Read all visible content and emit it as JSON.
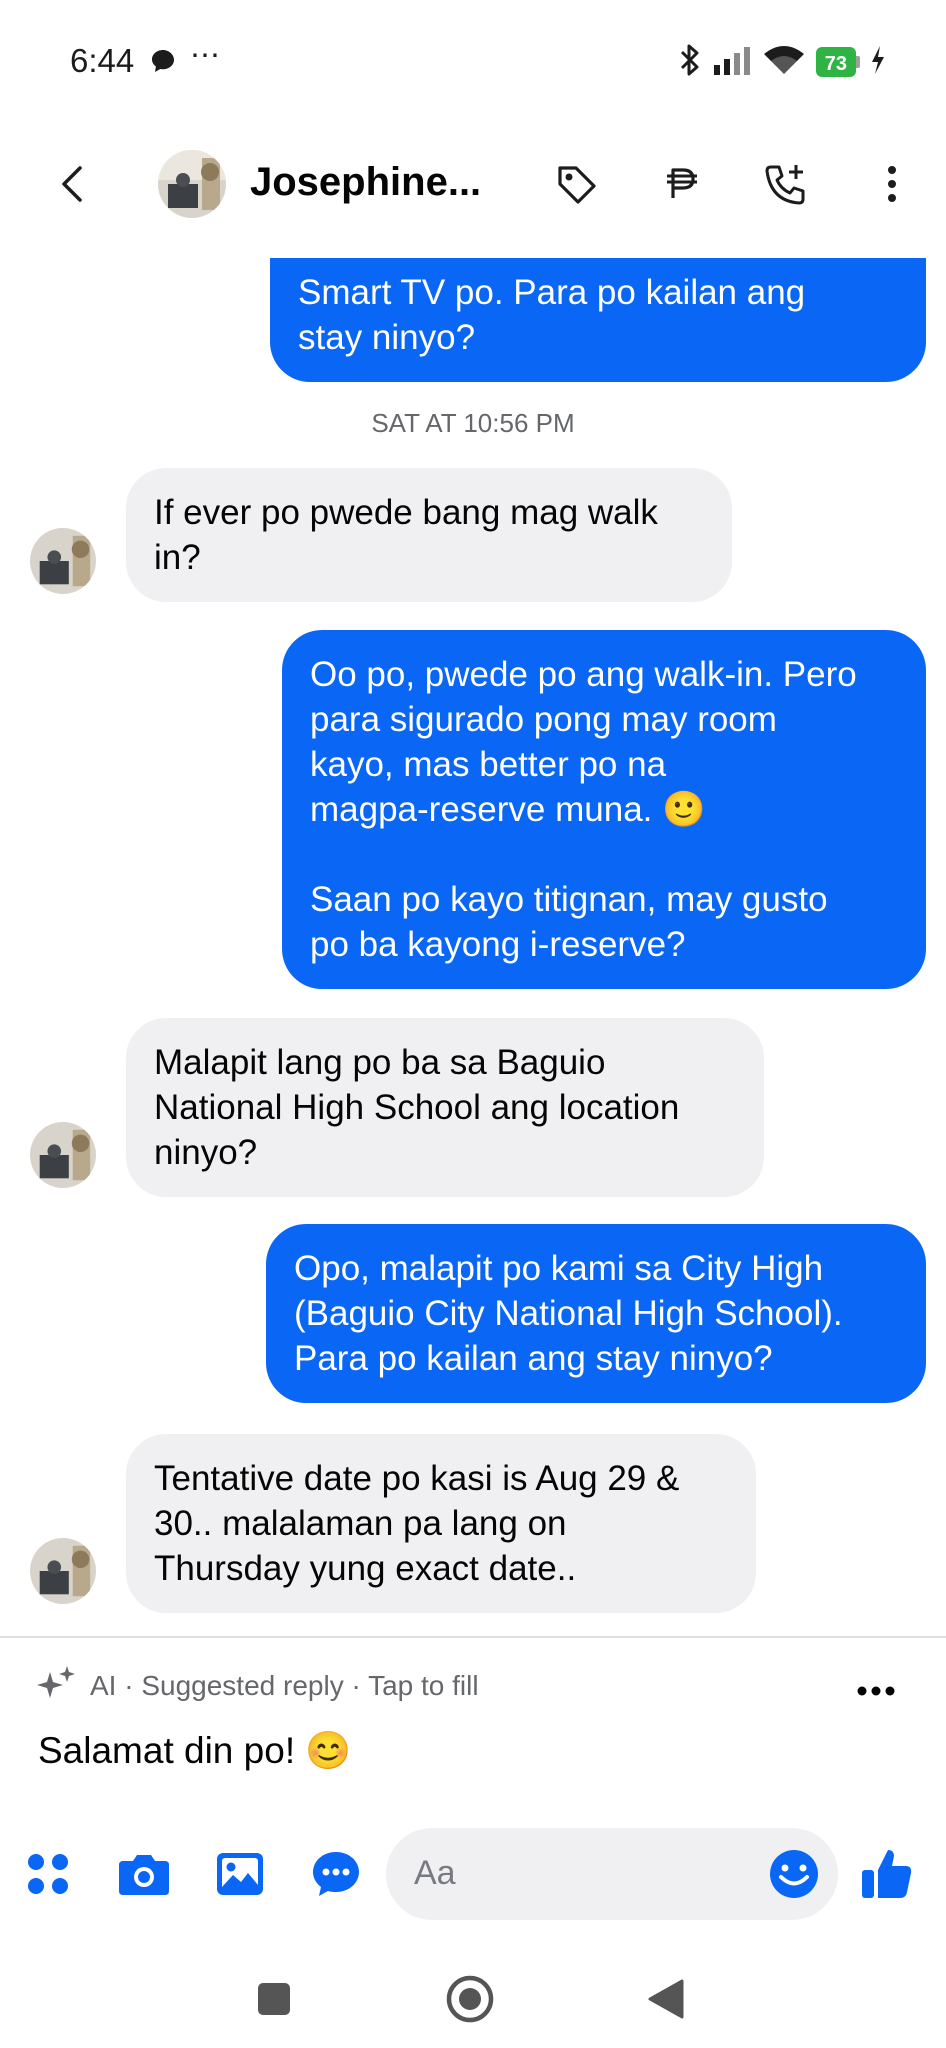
{
  "status_bar": {
    "time": "6:44",
    "dots": "⋯",
    "battery": "73"
  },
  "header": {
    "contact_name": "Josephine..."
  },
  "messages": {
    "out_1": "Smart TV po. Para po kailan ang\nstay ninyo?",
    "timestamp": "SAT AT 10:56 PM",
    "in_1": "If ever po pwede bang mag walk\nin?",
    "out_2": "Oo po, pwede po ang walk-in. Pero\npara sigurado pong may room\nkayo, mas better po na\nmagpa-reserve muna. 🙂\n\nSaan po kayo titignan, may gusto\npo ba kayong i-reserve?",
    "in_2": "Malapit lang po ba sa Baguio\nNational High School ang location\nninyo?",
    "out_3": "Opo, malapit po kami sa City High\n(Baguio City National High School).\nPara po kailan ang stay ninyo?",
    "in_3": "Tentative date po kasi is Aug 29 &\n30.. malalaman pa lang on\nThursday yung exact date.."
  },
  "suggestion": {
    "label": "AI · Suggested reply · Tap to fill",
    "reply": "Salamat din po! 😊"
  },
  "composer": {
    "placeholder": "Aa"
  },
  "colors": {
    "accent": "#0a66f5",
    "incoming_bubble": "#f0f0f2",
    "battery": "#2fb344"
  }
}
